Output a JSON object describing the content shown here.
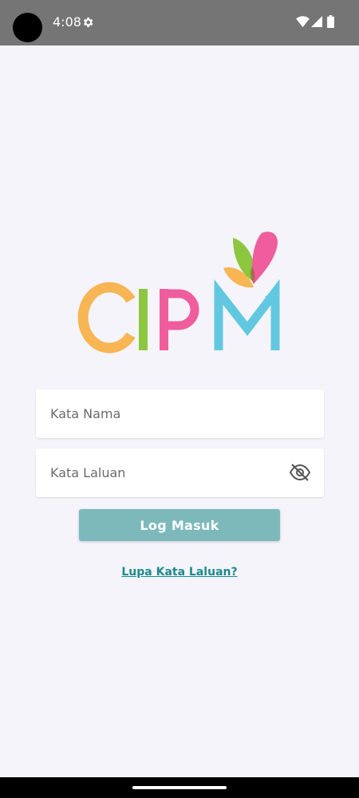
{
  "status_bar": {
    "time": "4:08",
    "icons": [
      "camera-cutout",
      "settings-icon",
      "wifi-icon",
      "signal-icon",
      "battery-icon"
    ]
  },
  "logo": {
    "text": "CIPM",
    "colors": {
      "c": "#f7b554",
      "i": "#8dc63f",
      "p": "#ef5d9c",
      "m": "#62c7e0",
      "drop_green": "#8dc63f",
      "drop_pink": "#ef5d9c",
      "drop_orange": "#f7b554"
    }
  },
  "form": {
    "username": {
      "placeholder": "Kata Nama",
      "value": ""
    },
    "password": {
      "placeholder": "Kata Laluan",
      "value": "",
      "toggle_icon": "eye-off-icon"
    },
    "login_label": "Log Masuk",
    "forgot_label": "Lupa Kata Laluan?"
  },
  "colors": {
    "background": "#f4f4fa",
    "status_bar": "#757575",
    "button": "#7db9bb",
    "link": "#1d8a8a"
  }
}
